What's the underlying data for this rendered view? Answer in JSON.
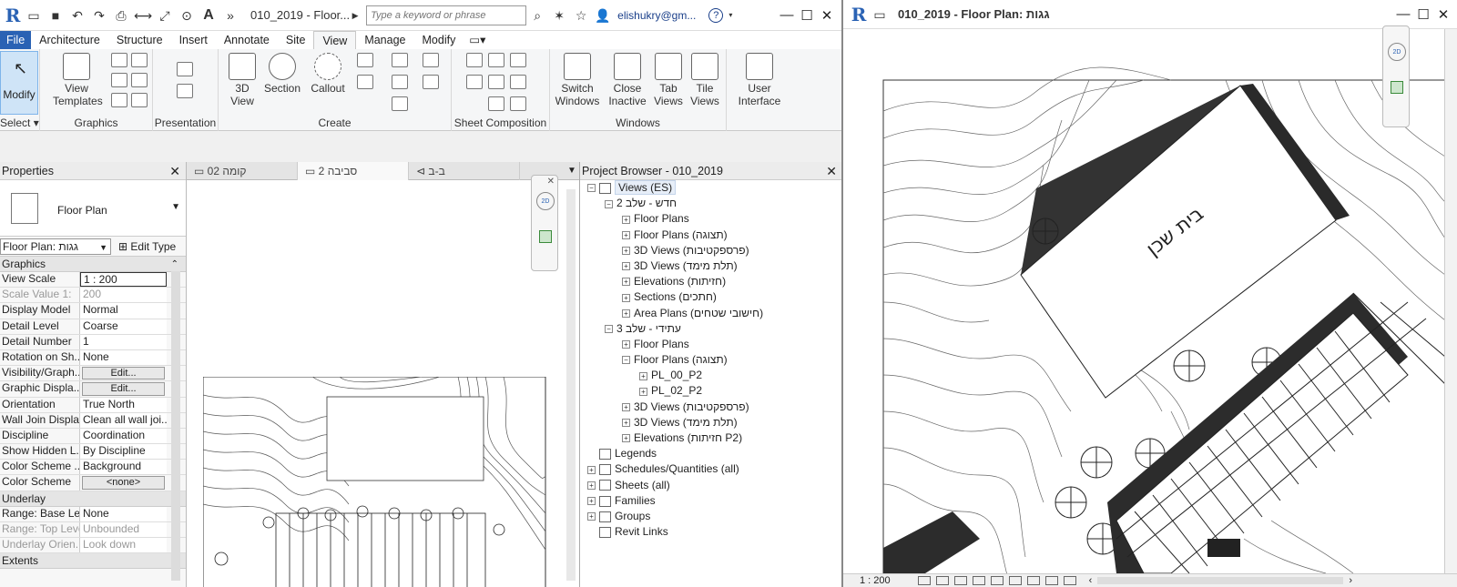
{
  "app": {
    "doc_title": "010_2019 - Floor...",
    "search_placeholder": "Type a keyword or phrase",
    "user": "elishukry@gm...",
    "help": "?"
  },
  "tabs": [
    "File",
    "Architecture",
    "Structure",
    "Insert",
    "Annotate",
    "Site",
    "View",
    "Manage",
    "Modify"
  ],
  "ribbon": {
    "modify_label": "Modify",
    "select_label": "Select",
    "panels": {
      "graphics": "Graphics",
      "presentation": "Presentation",
      "create": "Create",
      "sheet_composition": "Sheet Composition",
      "windows": "Windows"
    },
    "buttons": {
      "view_templates": "View Templates",
      "view_3d": "3D View",
      "section": "Section",
      "callout": "Callout",
      "switch_windows": "Switch Windows",
      "close_inactive": "Close Inactive",
      "tab_views": "Tab Views",
      "tile_views": "Tile Views",
      "user_interface": "User Interface"
    }
  },
  "properties": {
    "title": "Properties",
    "type_name": "Floor Plan",
    "instance": "Floor Plan: גגות",
    "edit_type": "Edit Type",
    "groups": {
      "graphics": "Graphics",
      "underlay": "Underlay",
      "extents": "Extents"
    },
    "rows": [
      {
        "k": "View Scale",
        "v": "1 : 200"
      },
      {
        "k": "Scale Value    1:",
        "v": "200"
      },
      {
        "k": "Display Model",
        "v": "Normal"
      },
      {
        "k": "Detail Level",
        "v": "Coarse"
      },
      {
        "k": "Detail Number",
        "v": "1"
      },
      {
        "k": "Rotation on Sh...",
        "v": "None"
      },
      {
        "k": "Visibility/Graph...",
        "v": "Edit..."
      },
      {
        "k": "Graphic Displa...",
        "v": "Edit..."
      },
      {
        "k": "Orientation",
        "v": "True North"
      },
      {
        "k": "Wall Join Display",
        "v": "Clean all wall joi..."
      },
      {
        "k": "Discipline",
        "v": "Coordination"
      },
      {
        "k": "Show Hidden L...",
        "v": "By Discipline"
      },
      {
        "k": "Color Scheme ...",
        "v": "Background"
      },
      {
        "k": "Color Scheme",
        "v": "<none>"
      }
    ],
    "underlay_rows": [
      {
        "k": "Range: Base Le...",
        "v": "None"
      },
      {
        "k": "Range: Top Level",
        "v": "Unbounded"
      },
      {
        "k": "Underlay Orien...",
        "v": "Look down"
      }
    ]
  },
  "view_tabs": [
    "קומה 02",
    "סביבה 2",
    "ב-ב"
  ],
  "browser": {
    "title": "Project Browser - 010_2019",
    "nodes": [
      {
        "label": "Views (ES)",
        "level": 0,
        "ex": "-"
      },
      {
        "label": "חדש - שלב 2",
        "level": 1,
        "ex": "-"
      },
      {
        "label": "Floor Plans",
        "level": 2,
        "ex": "+"
      },
      {
        "label": "Floor Plans (תצוגה)",
        "level": 2,
        "ex": "+"
      },
      {
        "label": "3D Views (פרספקטיבות)",
        "level": 2,
        "ex": "+"
      },
      {
        "label": "3D Views (תלת מימד)",
        "level": 2,
        "ex": "+"
      },
      {
        "label": "Elevations (חזיתות)",
        "level": 2,
        "ex": "+"
      },
      {
        "label": "Sections (חתכים)",
        "level": 2,
        "ex": "+"
      },
      {
        "label": "Area Plans (חישובי שטחים)",
        "level": 2,
        "ex": "+"
      },
      {
        "label": "עתידי - שלב 3",
        "level": 1,
        "ex": "-"
      },
      {
        "label": "Floor Plans",
        "level": 2,
        "ex": "+"
      },
      {
        "label": "Floor Plans (תצוגה)",
        "level": 2,
        "ex": "-"
      },
      {
        "label": "PL_00_P2",
        "level": 3,
        "ex": "+"
      },
      {
        "label": "PL_02_P2",
        "level": 3,
        "ex": "+"
      },
      {
        "label": "3D Views (פרספקטיבות)",
        "level": 2,
        "ex": "+"
      },
      {
        "label": "3D Views (תלת מימד)",
        "level": 2,
        "ex": "+"
      },
      {
        "label": "Elevations (חזיתות P2)",
        "level": 2,
        "ex": "+"
      },
      {
        "label": "Legends",
        "level": 0,
        "ex": ""
      },
      {
        "label": "Schedules/Quantities (all)",
        "level": 0,
        "ex": "+"
      },
      {
        "label": "Sheets (all)",
        "level": 0,
        "ex": "+"
      },
      {
        "label": "Families",
        "level": 0,
        "ex": "+"
      },
      {
        "label": "Groups",
        "level": 0,
        "ex": "+"
      },
      {
        "label": "Revit Links",
        "level": 0,
        "ex": ""
      }
    ]
  },
  "float_window": {
    "title": "010_2019 - Floor Plan: גגות",
    "building_label": "בית שכן",
    "scale": "1 : 200"
  },
  "colors": {
    "accent": "#2a62b4",
    "file_tab": "#2a62b4",
    "selected": "#cfe4f7"
  }
}
